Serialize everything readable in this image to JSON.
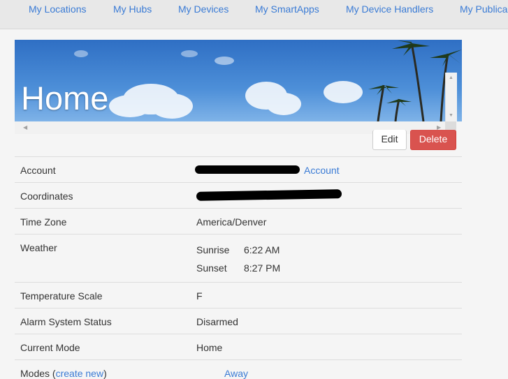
{
  "nav": {
    "items": [
      "My Locations",
      "My Hubs",
      "My Devices",
      "My SmartApps",
      "My Device Handlers",
      "My Publica"
    ]
  },
  "location": {
    "title": "Home"
  },
  "actions": {
    "edit_label": "Edit",
    "delete_label": "Delete"
  },
  "details": {
    "account_label": "Account",
    "account_link": "Account",
    "coordinates_label": "Coordinates",
    "timezone_label": "Time Zone",
    "timezone_value": "America/Denver",
    "weather_label": "Weather",
    "sunrise_label": "Sunrise",
    "sunrise_time": "6:22 AM",
    "sunset_label": "Sunset",
    "sunset_time": "8:27 PM",
    "temp_scale_label": "Temperature Scale",
    "temp_scale_value": "F",
    "alarm_label": "Alarm System Status",
    "alarm_value": "Disarmed",
    "mode_label": "Current Mode",
    "mode_value": "Home",
    "modes_label": "Modes (",
    "modes_create_link": "create new",
    "modes_label_end": ")",
    "modes_first": "Away"
  },
  "colors": {
    "link": "#3a7bd5",
    "delete_button": "#d9534f",
    "nav_bg": "#e8e8e8"
  }
}
